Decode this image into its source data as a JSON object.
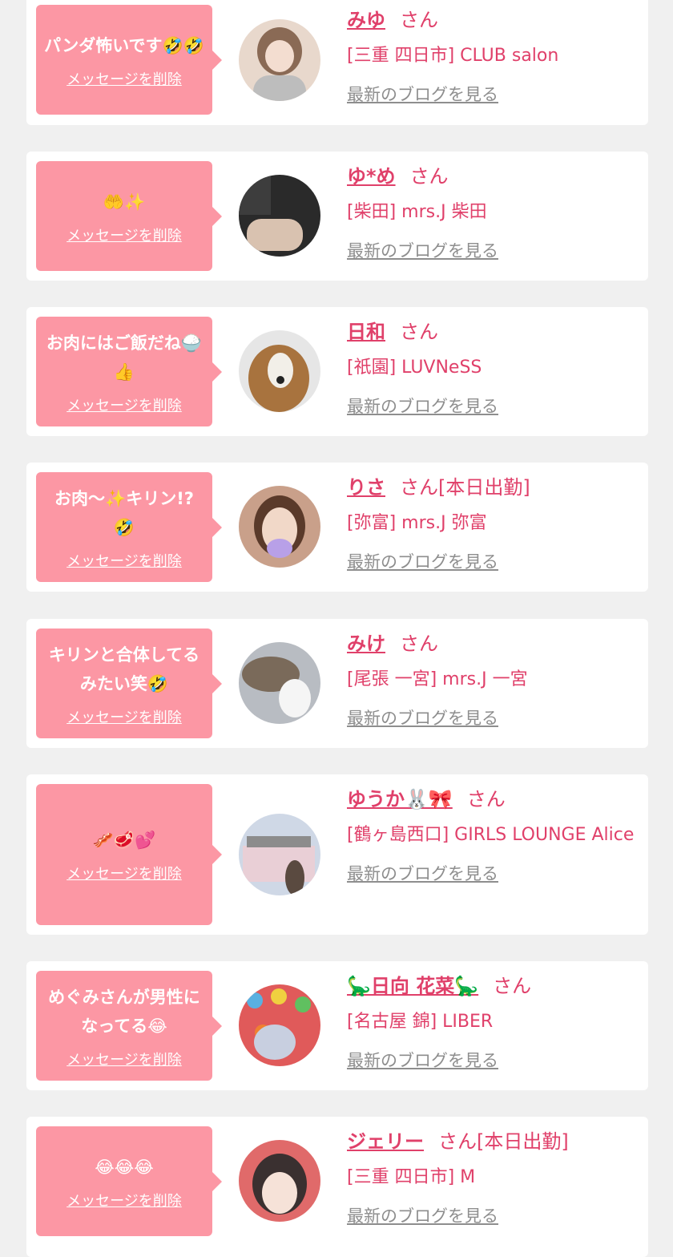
{
  "entries": [
    {
      "message": "パンダ怖いです🤣🤣",
      "delete_label": "メッセージを削除",
      "name": "みゆ",
      "suffix": "さん",
      "shop": "[三重 四日市] CLUB salon",
      "blog_label": "最新のブログを見る",
      "avatar_colors": [
        "#e8d8cc",
        "#8a6a55"
      ]
    },
    {
      "message": "🤲✨",
      "delete_label": "メッセージを削除",
      "name": "ゆ*め",
      "suffix": "さん",
      "shop": "[柴田] mrs.J 柴田",
      "blog_label": "最新のブログを見る",
      "avatar_colors": [
        "#2a2a2a",
        "#d9c2b0"
      ]
    },
    {
      "message": "お肉にはご飯だね🍚👍",
      "delete_label": "メッセージを削除",
      "name": "日和",
      "suffix": "さん",
      "shop": "[祇園] LUVNeSS",
      "blog_label": "最新のブログを見る",
      "avatar_colors": [
        "#e6e6e6",
        "#a8733e"
      ]
    },
    {
      "message": "お肉〜✨キリン!?🤣",
      "delete_label": "メッセージを削除",
      "name": "りさ",
      "suffix": "さん[本日出勤]",
      "shop": "[弥富] mrs.J 弥富",
      "blog_label": "最新のブログを見る",
      "avatar_colors": [
        "#c9a08a",
        "#b8a0e8"
      ]
    },
    {
      "message": "キリンと合体してるみたい笑🤣",
      "delete_label": "メッセージを削除",
      "name": "みけ",
      "suffix": "さん",
      "shop": "[尾張 一宮] mrs.J 一宮",
      "blog_label": "最新のブログを見る",
      "avatar_colors": [
        "#b8bcc2",
        "#f5f5f5"
      ]
    },
    {
      "message": "🥓🥩💕",
      "delete_label": "メッセージを削除",
      "name": "ゆうか🐰🎀",
      "suffix": "さん",
      "shop": "[鶴ヶ島西口] GIRLS LOUNGE Alice",
      "blog_label": "最新のブログを見る",
      "avatar_colors": [
        "#cfd8e6",
        "#e9cfd6"
      ]
    },
    {
      "message": "めぐみさんが男性になってる😂",
      "delete_label": "メッセージを削除",
      "name": "🦕日向 花菜🦕",
      "suffix": "さん",
      "shop": "[名古屋 錦] LIBER",
      "blog_label": "最新のブログを見る",
      "avatar_colors": [
        "#e05a5a",
        "#5ab0e0"
      ]
    },
    {
      "message": "😂😂😂",
      "delete_label": "メッセージを削除",
      "name": "ジェリー",
      "suffix": "さん[本日出勤]",
      "shop": "[三重 四日市] M",
      "blog_label": "最新のブログを見る",
      "avatar_colors": [
        "#e06a6a",
        "#2a2a2a"
      ]
    }
  ]
}
